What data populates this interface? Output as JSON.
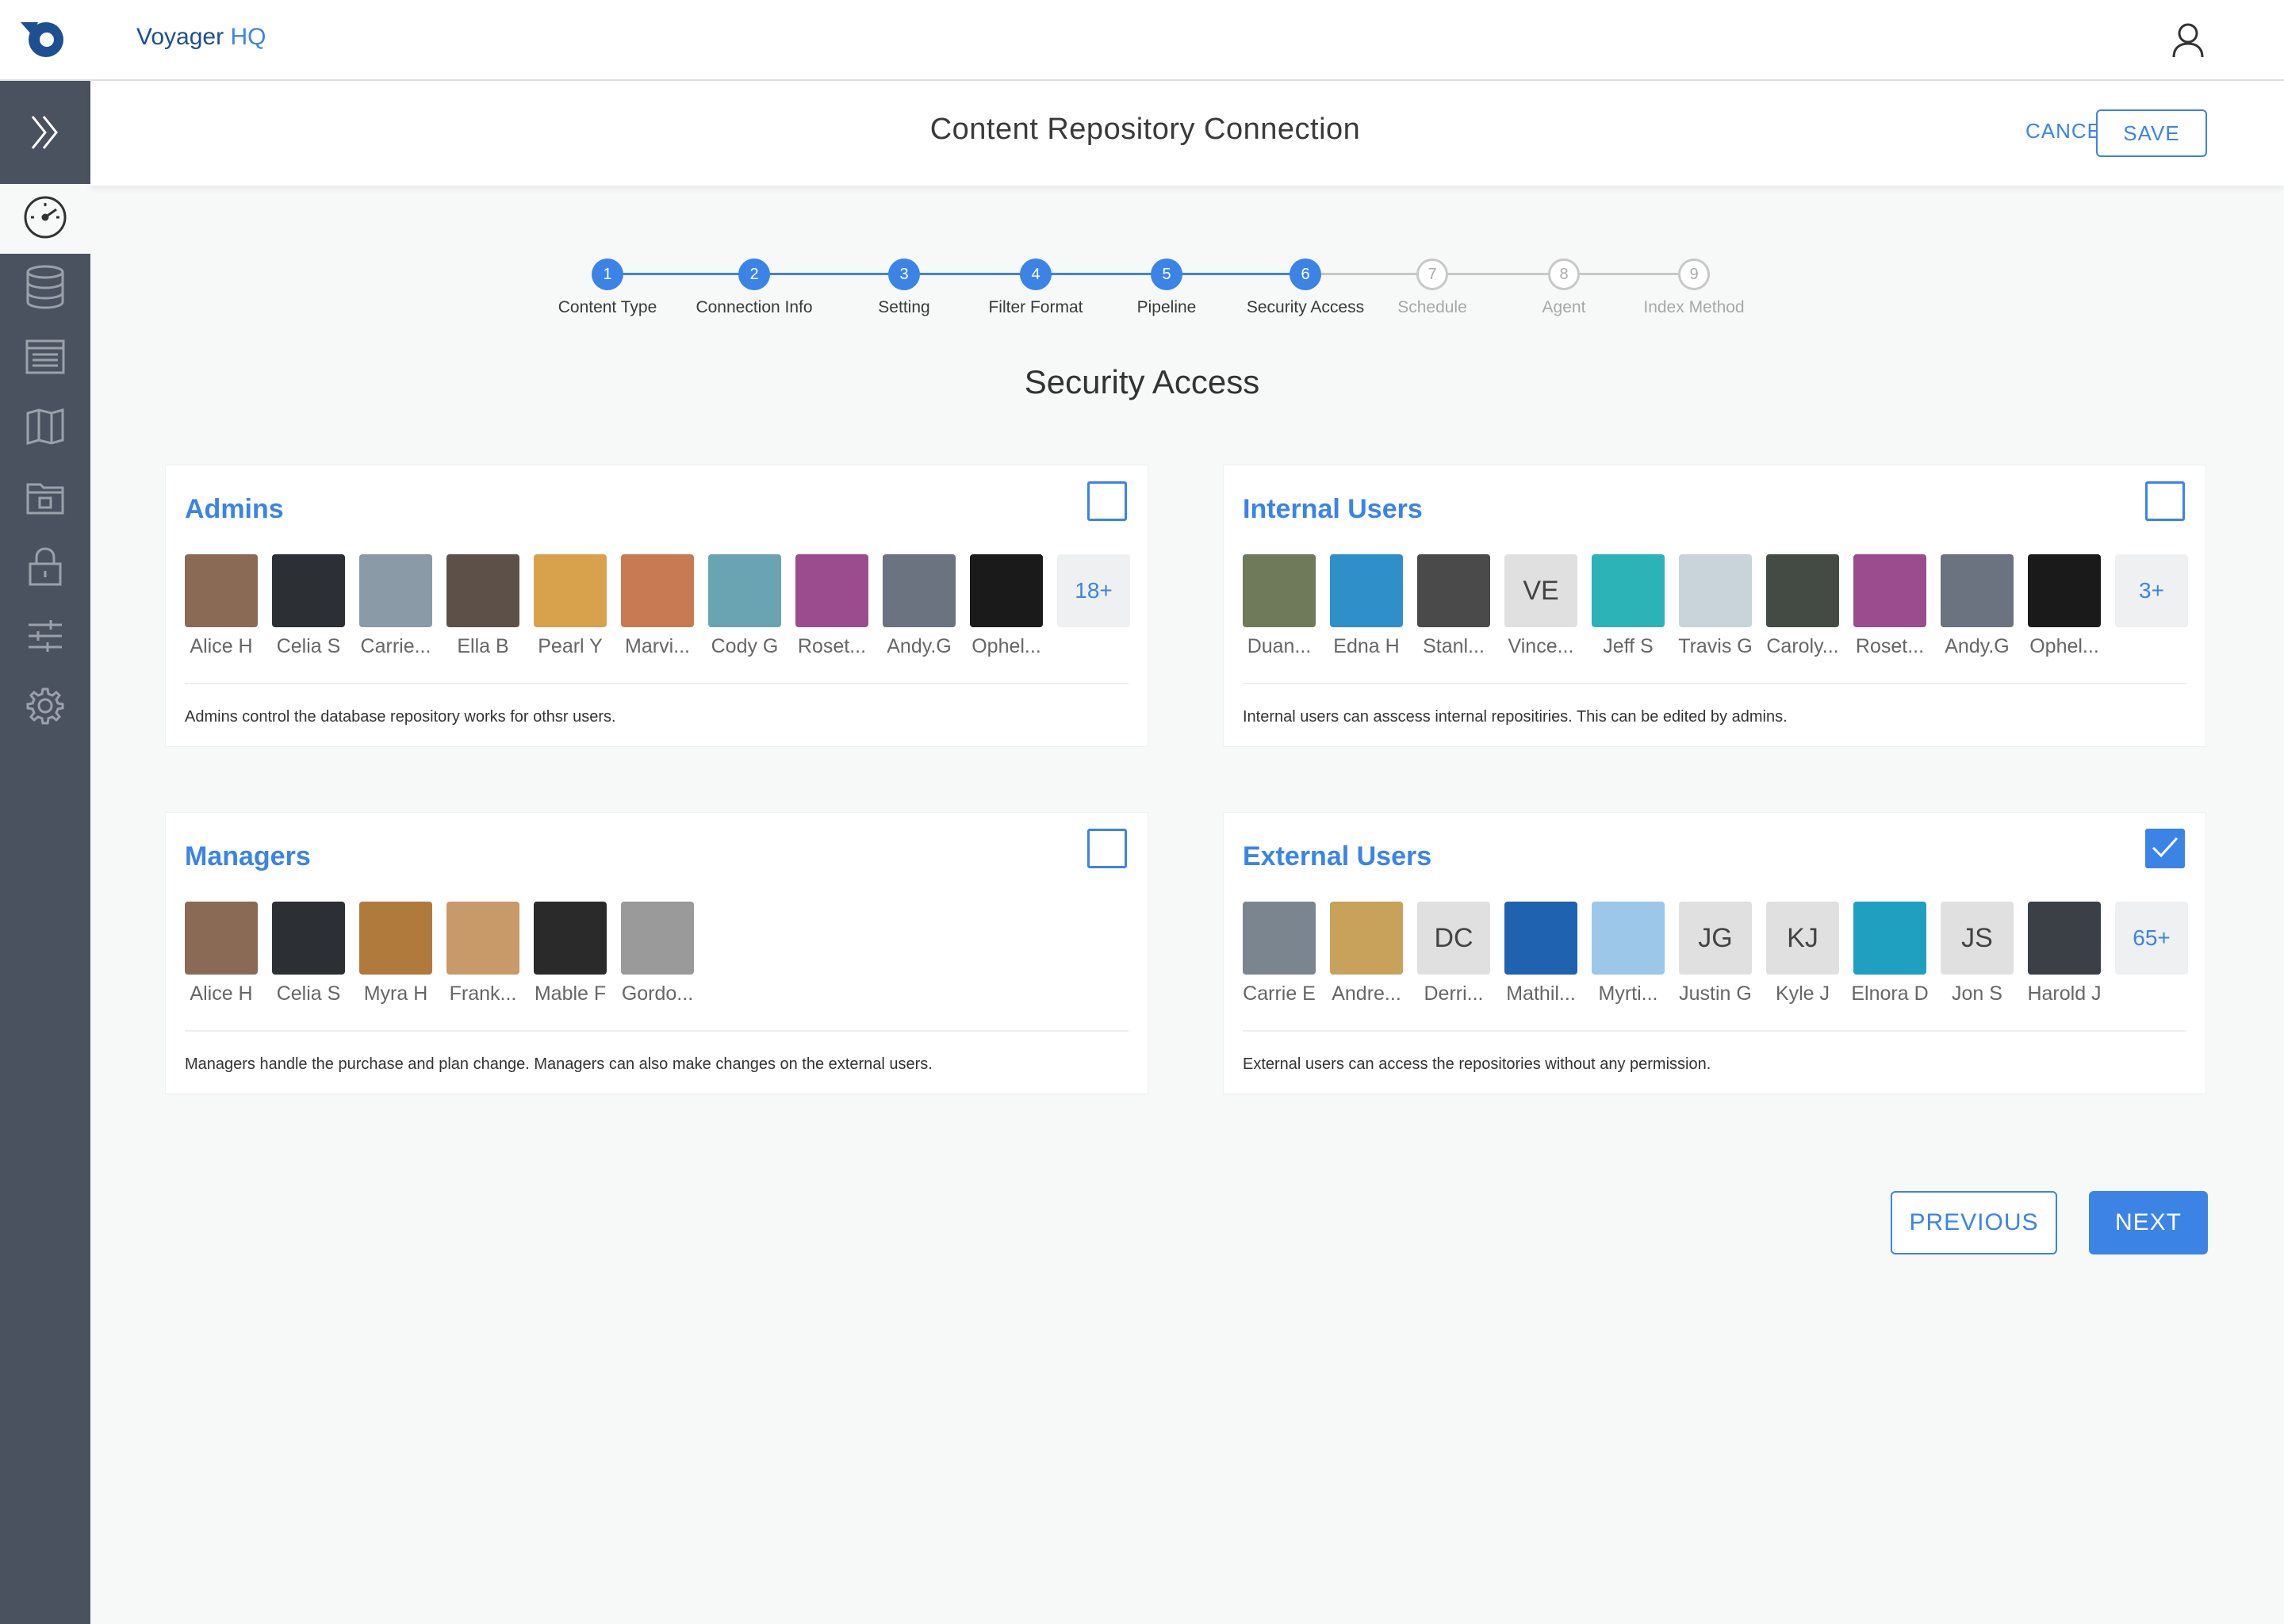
{
  "header": {
    "brand": "Voyager",
    "brand_suffix": "HQ"
  },
  "page": {
    "title": "Content Repository Connection",
    "cancel_label": "CANCEL",
    "save_label": "SAVE"
  },
  "sidebar": {
    "items": [
      {
        "icon": "gauge-icon",
        "active": true
      },
      {
        "icon": "database-icon",
        "active": false
      },
      {
        "icon": "list-icon",
        "active": false
      },
      {
        "icon": "map-icon",
        "active": false
      },
      {
        "icon": "folder-icon",
        "active": false
      },
      {
        "icon": "lock-icon",
        "active": false
      },
      {
        "icon": "sliders-icon",
        "active": false
      },
      {
        "icon": "gear-icon",
        "active": false
      }
    ]
  },
  "stepper": {
    "steps": [
      {
        "num": "1",
        "label": "Content Type",
        "done": true
      },
      {
        "num": "2",
        "label": "Connection Info",
        "done": true
      },
      {
        "num": "3",
        "label": "Setting",
        "done": true
      },
      {
        "num": "4",
        "label": "Filter Format",
        "done": true
      },
      {
        "num": "5",
        "label": "Pipeline",
        "done": true
      },
      {
        "num": "6",
        "label": "Security Access",
        "done": true
      },
      {
        "num": "7",
        "label": "Schedule",
        "done": false
      },
      {
        "num": "8",
        "label": "Agent",
        "done": false
      },
      {
        "num": "9",
        "label": "Index Method",
        "done": false
      }
    ]
  },
  "section_title": "Security Access",
  "groups": [
    {
      "title": "Admins",
      "checked": false,
      "description": "Admins control the database repository works for othsr users.",
      "more": "18+",
      "members": [
        "Alice H",
        "Celia S",
        "Carrie...",
        "Ella B",
        "Pearl Y",
        "Marvi...",
        "Cody G",
        "Roset...",
        "Andy.G",
        "Ophel..."
      ],
      "colors": [
        "#8b6a55",
        "#2c2f33",
        "#8a9aa6",
        "#5c5048",
        "#d8a14b",
        "#c87a52",
        "#6aa3b2",
        "#9b4c8f",
        "#6b7380",
        "#1a1a1a"
      ],
      "initials": [
        "",
        "",
        "",
        "",
        "",
        "",
        "",
        "",
        "",
        ""
      ]
    },
    {
      "title": "Internal Users",
      "checked": false,
      "description": "Internal users can asscess internal repositiries. This can be edited by admins.",
      "more": "3+",
      "members": [
        "Duan...",
        "Edna H",
        "Stanl...",
        "Vince...",
        "Jeff S",
        "Travis G",
        "Caroly...",
        "Roset...",
        "Andy.G",
        "Ophel..."
      ],
      "colors": [
        "#6e7a5a",
        "#2f8fc9",
        "#4a4a4a",
        "#e0e0e0",
        "#2bb3b8",
        "#c9d3da",
        "#444b45",
        "#9b4c8f",
        "#6b7380",
        "#1a1a1a"
      ],
      "initials": [
        "",
        "",
        "",
        "VE",
        "",
        "",
        "",
        "",
        "",
        ""
      ]
    },
    {
      "title": "Managers",
      "checked": false,
      "description": "Managers handle the purchase and plan change. Managers can also make changes on the external users.",
      "more": "",
      "members": [
        "Alice H",
        "Celia S",
        "Myra H",
        "Frank...",
        "Mable F",
        "Gordo..."
      ],
      "colors": [
        "#8b6a55",
        "#2c2f33",
        "#b07a3c",
        "#c89a6a",
        "#2a2a2a",
        "#9a9a9a"
      ],
      "initials": [
        "",
        "",
        "",
        "",
        "",
        ""
      ]
    },
    {
      "title": "External Users",
      "checked": true,
      "description": "External users can access the repositories without any permission.",
      "more": "65+",
      "members": [
        "Carrie E",
        "Andre...",
        "Derri...",
        "Mathil...",
        "Myrti...",
        "Justin G",
        "Kyle J",
        "Elnora D",
        "Jon S",
        "Harold J"
      ],
      "colors": [
        "#7a8590",
        "#c8a25a",
        "#e0e0e0",
        "#1e62b0",
        "#9cc7e8",
        "#e0e0e0",
        "#e0e0e0",
        "#1fa0c0",
        "#e0e0e0",
        "#3a4045"
      ],
      "initials": [
        "",
        "",
        "DC",
        "",
        "",
        "JG",
        "KJ",
        "",
        "JS",
        ""
      ]
    }
  ],
  "nav": {
    "previous_label": "PREVIOUS",
    "next_label": "NEXT"
  },
  "colors": {
    "accent": "#3b84e6",
    "sidebar": "#4b525f",
    "brand_dark": "#1d4f91"
  }
}
